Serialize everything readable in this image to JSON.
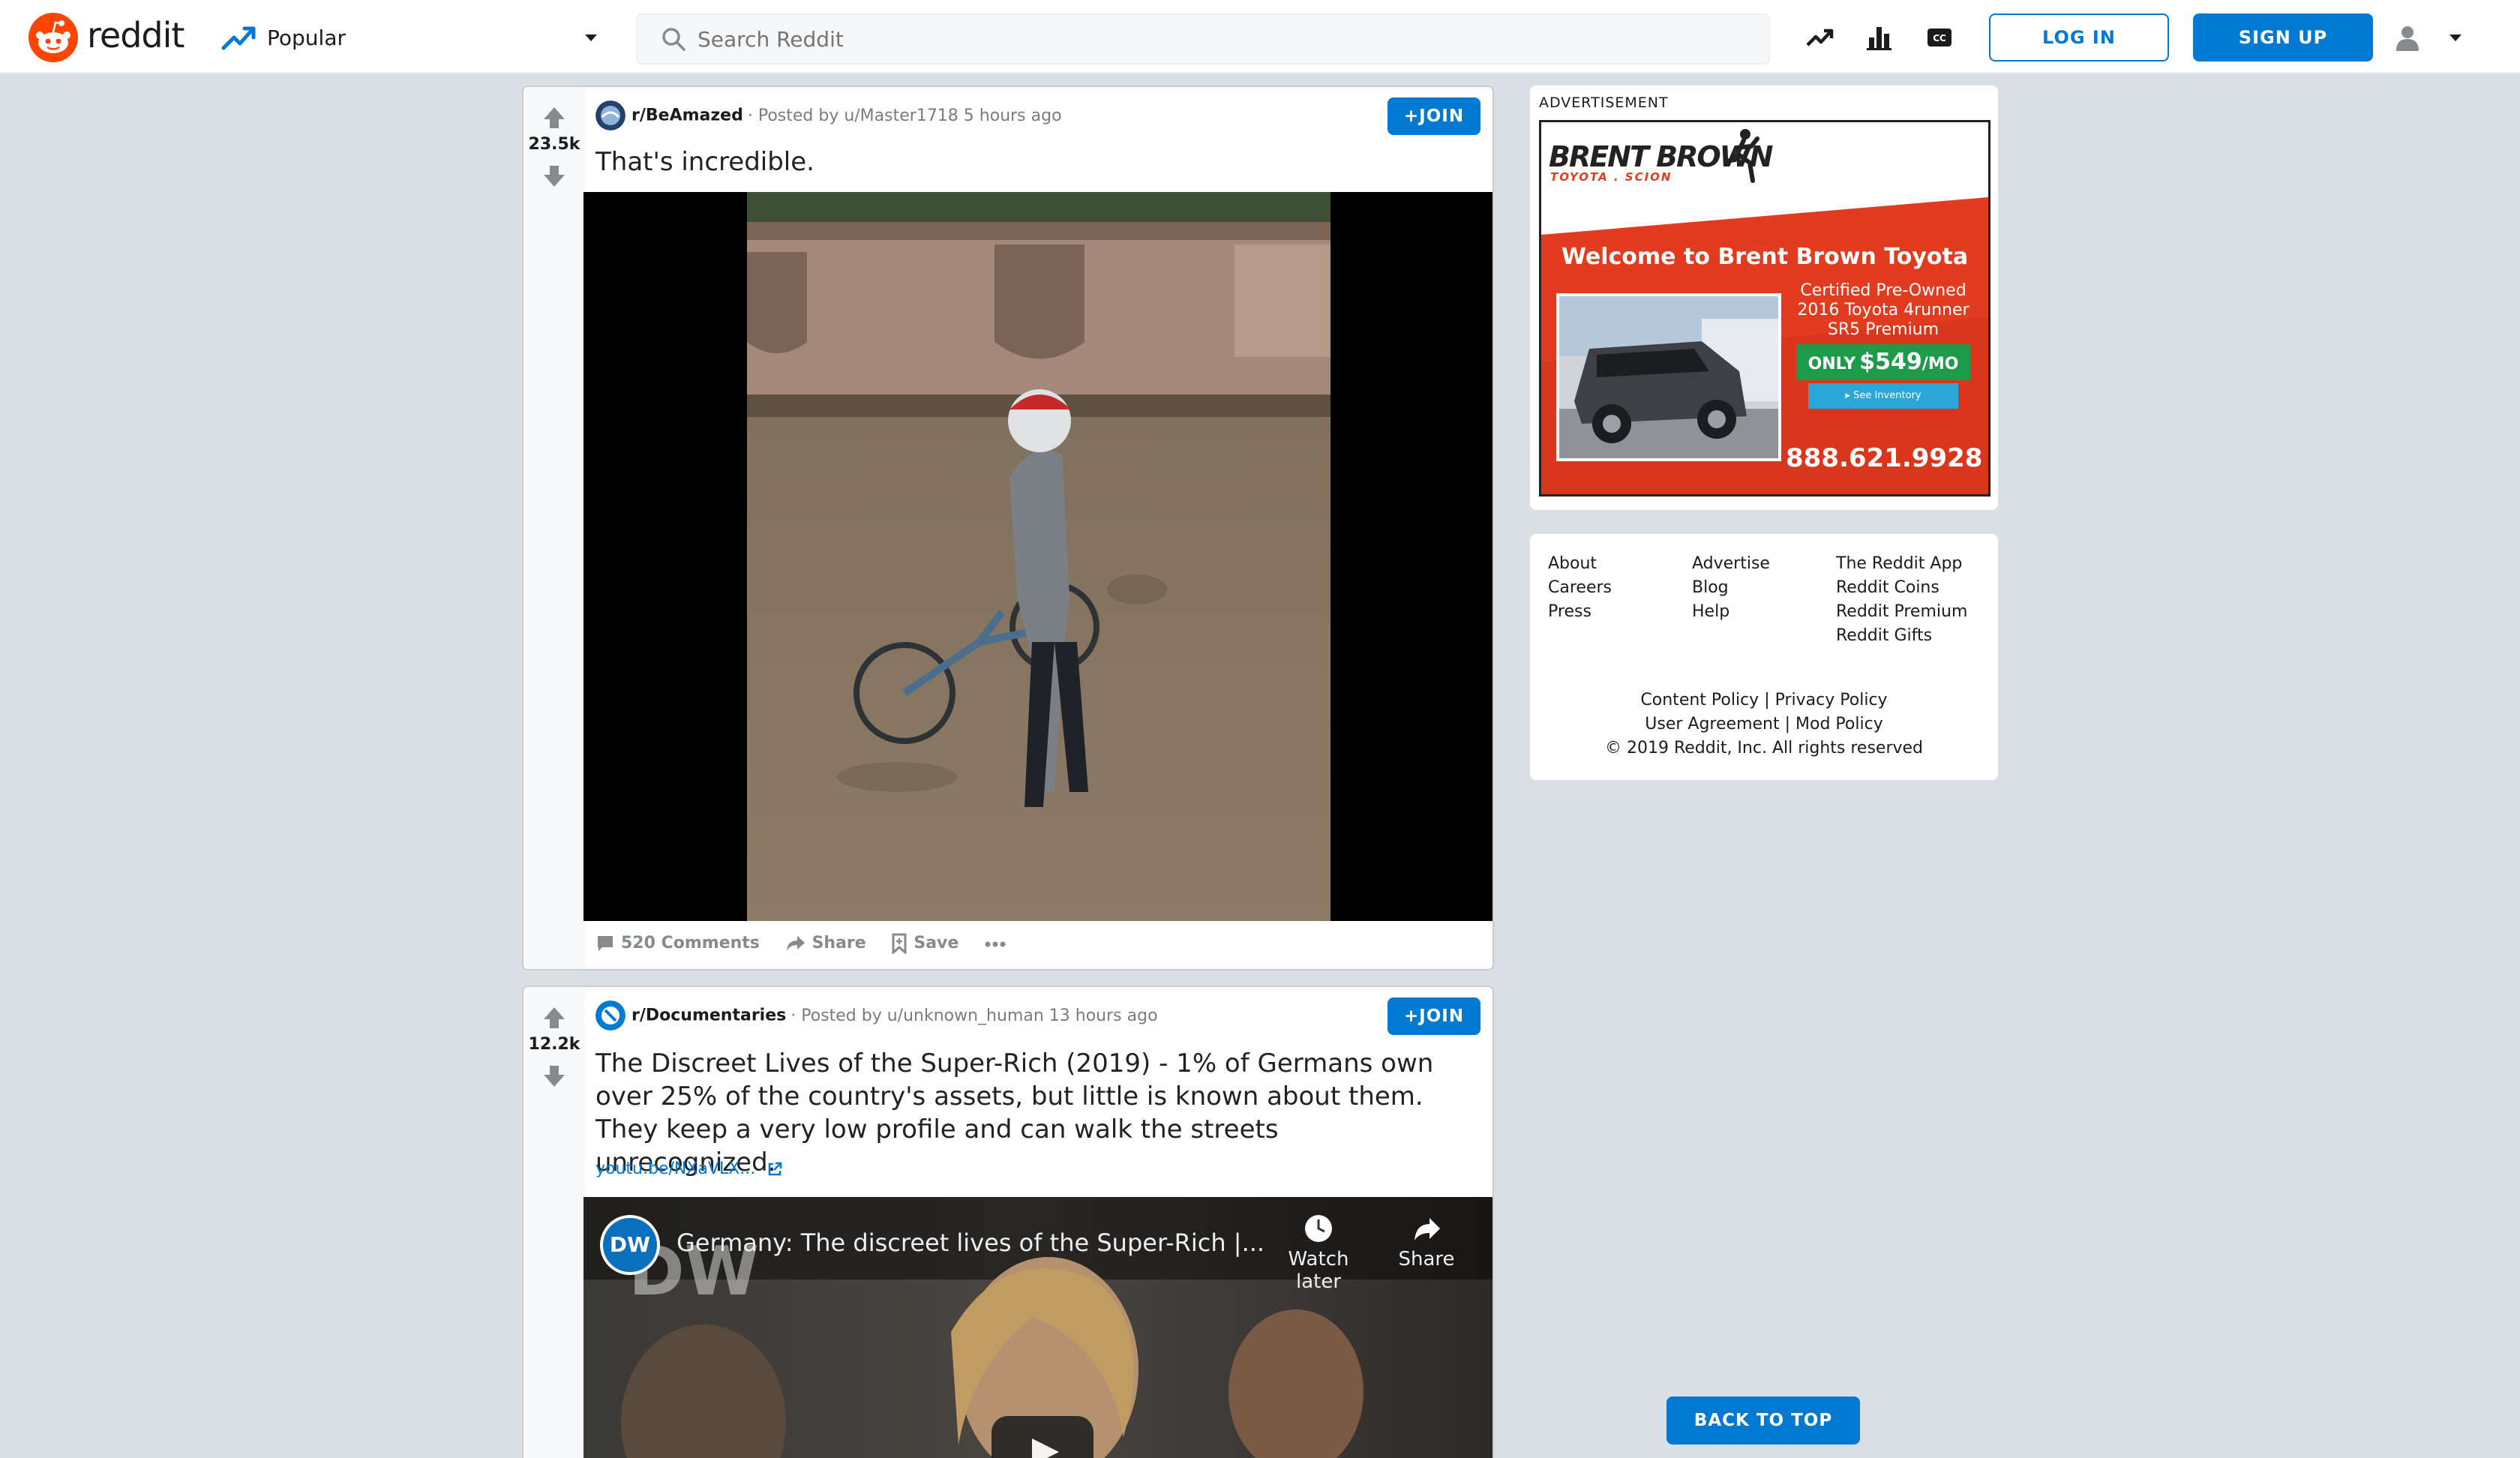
{
  "header": {
    "brand": "reddit",
    "feed_label": "Popular",
    "search_placeholder": "Search Reddit",
    "login_label": "LOG IN",
    "signup_label": "SIGN UP"
  },
  "posts": [
    {
      "score": "23.5k",
      "subreddit": "r/BeAmazed",
      "posted": "· Posted by u/Master1718 5 hours ago",
      "join_label": "JOIN",
      "title": "That's incredible.",
      "comments_label": "520 Comments",
      "share_label": "Share",
      "save_label": "Save"
    },
    {
      "score": "12.2k",
      "subreddit": "r/Documentaries",
      "posted": "· Posted by u/unknown_human 13 hours ago",
      "join_label": "JOIN",
      "title": "The Discreet Lives of the Super-Rich (2019) - 1% of Germans own over 25% of the country's assets, but little is known about them. They keep a very low profile and can walk the streets unrecognized.",
      "link": "youtu.be/NXaVLX...",
      "video": {
        "channel": "DW",
        "title": "Germany: The discreet lives of the Super-Rich |...",
        "watch_later": "Watch later",
        "share": "Share"
      }
    }
  ],
  "ad": {
    "label": "ADVERTISEMENT",
    "brand": "BRENT BROWN",
    "brand_sub": "TOYOTA . SCION",
    "headline": "Welcome to Brent Brown Toyota",
    "offer_line1": "Certified Pre-Owned",
    "offer_line2": "2016 Toyota 4runner",
    "offer_line3": "SR5 Premium",
    "price_prefix": "ONLY",
    "price": "$549",
    "price_suffix": "/MO",
    "cta": "See Inventory",
    "phone": "888.621.9928"
  },
  "footer": {
    "col1": [
      "About",
      "Careers",
      "Press"
    ],
    "col2": [
      "Advertise",
      "Blog",
      "Help"
    ],
    "col3": [
      "The Reddit App",
      "Reddit Coins",
      "Reddit Premium",
      "Reddit Gifts"
    ],
    "policy_row1_a": "Content Policy",
    "policy_row1_b": "Privacy Policy",
    "policy_row2_a": "User Agreement",
    "policy_row2_b": "Mod Policy",
    "copyright": "© 2019 Reddit, Inc. All rights reserved",
    "separator": "|"
  },
  "back_to_top_label": "BACK TO TOP",
  "colors": {
    "accent": "#0079d3",
    "brand_orange": "#ff4500",
    "page_bg": "#dae0e6",
    "ad_red": "#e33b1f"
  }
}
